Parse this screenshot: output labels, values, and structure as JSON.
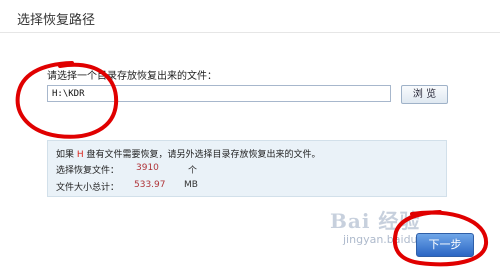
{
  "page": {
    "title": "选择恢复路径"
  },
  "path_section": {
    "prompt": "请选择一个目录存放恢复出来的文件：",
    "path_value": "H:\\KDR",
    "browse_label": "浏 览"
  },
  "info": {
    "line1_prefix": "如果",
    "drive_letter": "H",
    "line1_suffix": "盘有文件需要恢复，请另外选择目录存放恢复出来的文件。",
    "files_label": "选择恢复文件：",
    "files_value": "3910",
    "files_unit": "个",
    "size_label": "文件大小总计：",
    "size_value": "533.97",
    "size_unit": "MB"
  },
  "footer": {
    "next_label": "下一步"
  },
  "watermark": {
    "logo": "Bai 经验",
    "url": "jingyan.baidu.com"
  },
  "annotation_color": "#e00000"
}
